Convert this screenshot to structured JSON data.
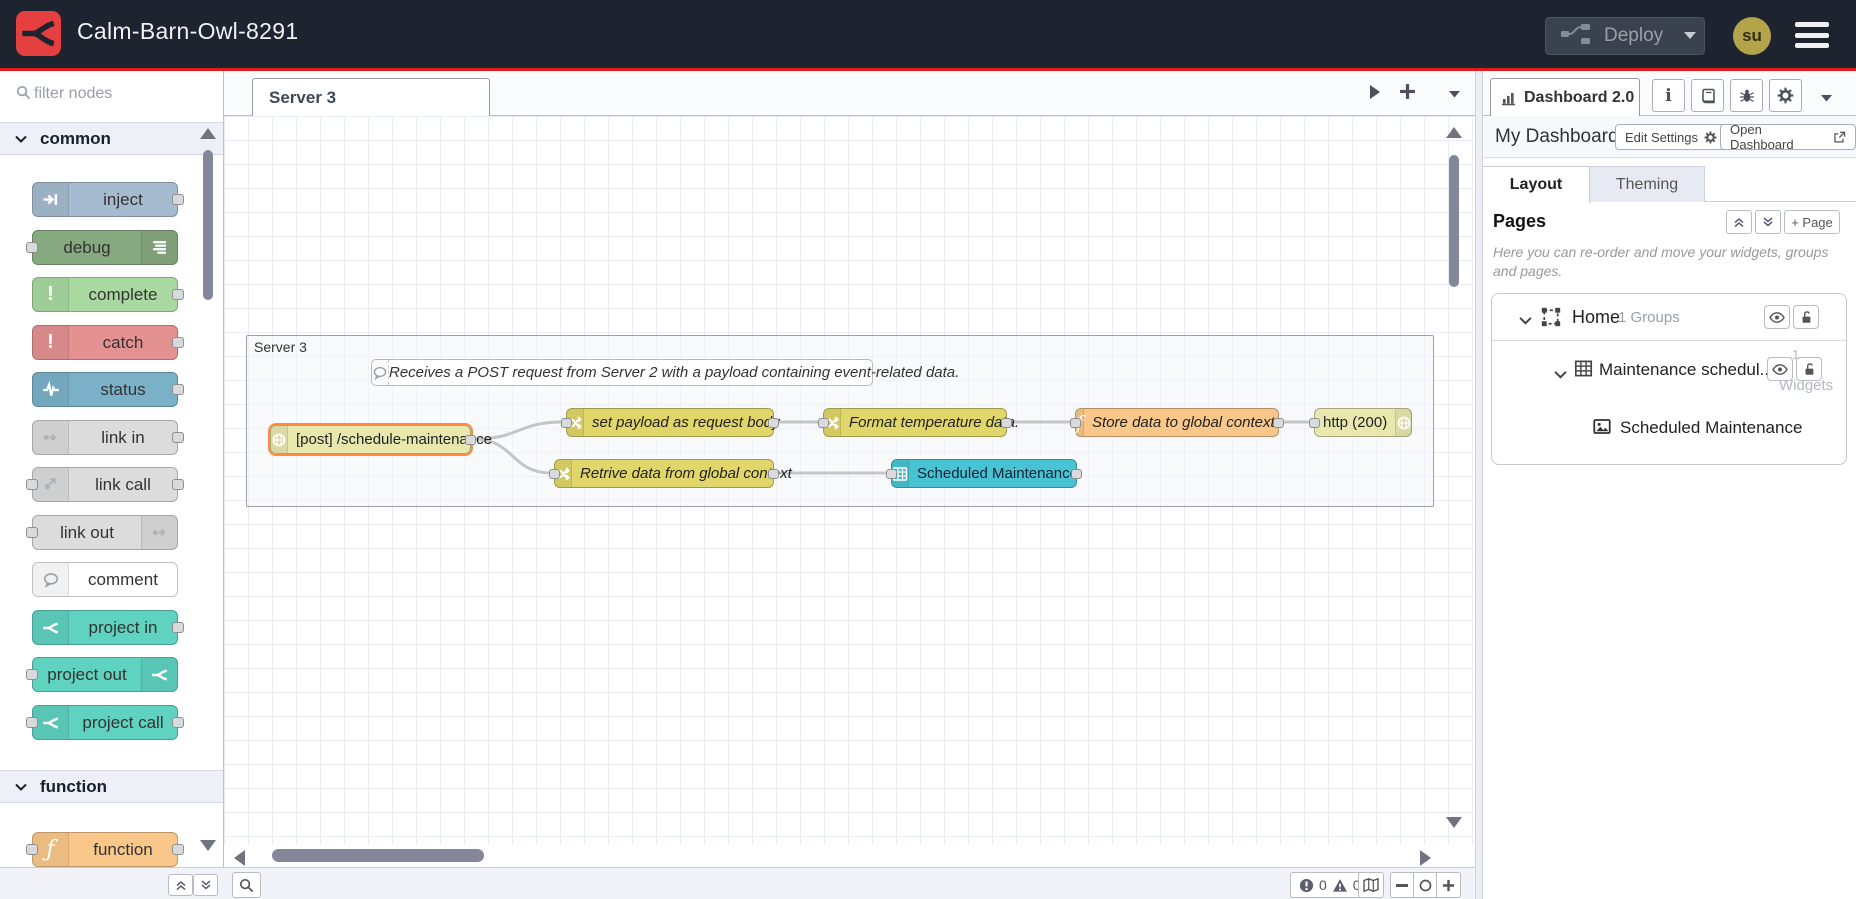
{
  "colors": {
    "header_bg": "#1d2430",
    "accent_red": "#dd1c1c",
    "logo_red": "#e5403f",
    "avatar_bg": "#b3a44c",
    "selection_orange": "#ff8b3d",
    "node_inject": "#a6bbcf",
    "node_debug": "#87a980",
    "node_complete": "#a9d9a0",
    "node_catch": "#e49191",
    "node_status": "#7ab1c9",
    "node_link": "#dcdcdc",
    "node_project": "#5fd2c0",
    "node_function": "#f9c78a",
    "node_change": "#e0d66a",
    "node_http": "#e7e7ae",
    "node_ui_table": "#47c3d3"
  },
  "header": {
    "title": "Calm-Barn-Owl-8291",
    "deploy": "Deploy",
    "avatar": "su"
  },
  "palette": {
    "filter_placeholder": "filter nodes",
    "categories": [
      {
        "label": "common",
        "nodes": [
          {
            "label": "inject"
          },
          {
            "label": "debug"
          },
          {
            "label": "complete"
          },
          {
            "label": "catch"
          },
          {
            "label": "status"
          },
          {
            "label": "link in"
          },
          {
            "label": "link call"
          },
          {
            "label": "link out"
          },
          {
            "label": "comment"
          },
          {
            "label": "project in"
          },
          {
            "label": "project out"
          },
          {
            "label": "project call"
          }
        ]
      },
      {
        "label": "function",
        "nodes": [
          {
            "label": "function"
          }
        ]
      }
    ]
  },
  "workspace": {
    "tab": "Server 3",
    "group_label": "Server 3",
    "comment": "Receives a POST request from Server 2 with a payload containing event-related data.",
    "nodes": [
      {
        "label": "[post] /schedule-maintenance"
      },
      {
        "label": "set payload as request body"
      },
      {
        "label": "Format temperature data."
      },
      {
        "label": "Store data to global context"
      },
      {
        "label": "http (200)"
      },
      {
        "label": "Retrive data from global context"
      },
      {
        "label": "Scheduled Maintenance"
      }
    ],
    "status": {
      "errors": "0",
      "warnings": "0"
    }
  },
  "sidebar": {
    "tab": "Dashboard 2.0",
    "dashboard_name": "My Dashboard",
    "edit_settings": "Edit Settings",
    "open_dashboard": "Open Dashboard",
    "tabs": {
      "layout": "Layout",
      "theming": "Theming"
    },
    "pages": {
      "title": "Pages",
      "add_page": "+ Page",
      "description": "Here you can re-order and move your widgets, groups and pages."
    },
    "tree": {
      "page": {
        "label": "Home",
        "meta": "1 Groups"
      },
      "group": {
        "label": "Maintenance schedul...",
        "meta_count": "1",
        "meta_label": "Widgets"
      },
      "widget": {
        "label": "Scheduled Maintenance"
      }
    }
  }
}
